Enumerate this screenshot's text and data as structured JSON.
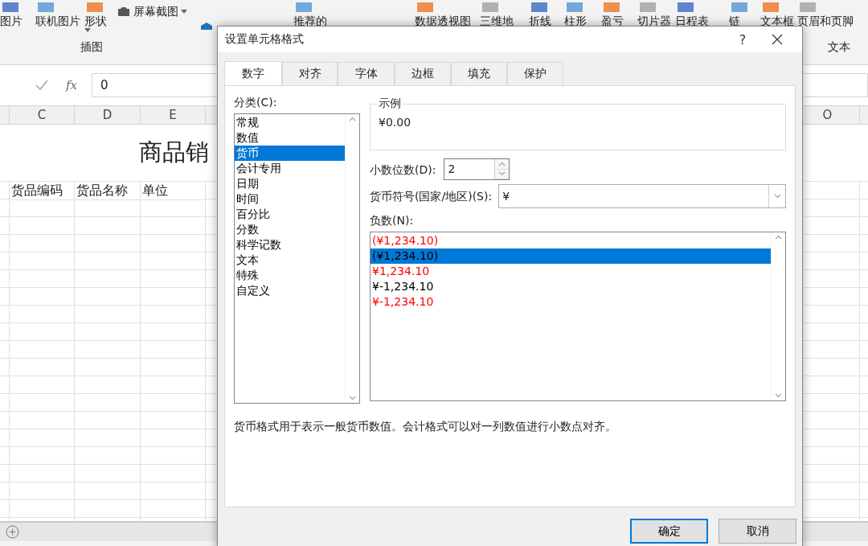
{
  "ribbon": {
    "items": [
      {
        "kind": "large",
        "label": "图片",
        "dropdown": false
      },
      {
        "kind": "large",
        "label": "联机图片",
        "dropdown": false
      },
      {
        "kind": "large",
        "label": "形状",
        "dropdown": true
      },
      {
        "kind": "stack",
        "entries": [
          {
            "label": "屏幕截图",
            "dropdown": true
          }
        ]
      },
      {
        "kind": "addin"
      },
      {
        "kind": "large",
        "label": "推荐的",
        "dropdown": false
      },
      {
        "kind": "large",
        "label": "数据透视图",
        "dropdown": false
      },
      {
        "kind": "large",
        "label": "三维地",
        "dropdown": false
      },
      {
        "kind": "large",
        "label": "折线",
        "dropdown": false
      },
      {
        "kind": "large",
        "label": "柱形",
        "dropdown": false
      },
      {
        "kind": "large",
        "label": "盈亏",
        "dropdown": false
      },
      {
        "kind": "large",
        "label": "切片器",
        "dropdown": false
      },
      {
        "kind": "large",
        "label": "日程表",
        "dropdown": false
      },
      {
        "kind": "large",
        "label": "链",
        "dropdown": false
      },
      {
        "kind": "large",
        "label": "文本框",
        "dropdown": false
      },
      {
        "kind": "large",
        "label": "页眉和页脚",
        "dropdown": false
      }
    ],
    "groups": [
      {
        "label": "插图"
      },
      {
        "label": "文本"
      }
    ]
  },
  "formula_bar": {
    "fx": "fx",
    "value": "0"
  },
  "sheet": {
    "columns": [
      "C",
      "D",
      "E",
      "O"
    ],
    "title": "商品销",
    "headers": [
      "货品编码",
      "货品名称",
      "单位"
    ]
  },
  "dialog": {
    "title": "设置单元格格式",
    "help": "?",
    "tabs": [
      {
        "label": "数字",
        "selected": true
      },
      {
        "label": "对齐",
        "selected": false
      },
      {
        "label": "字体",
        "selected": false
      },
      {
        "label": "边框",
        "selected": false
      },
      {
        "label": "填充",
        "selected": false
      },
      {
        "label": "保护",
        "selected": false
      }
    ],
    "category_label": "分类(C):",
    "categories": [
      {
        "label": "常规",
        "selected": false
      },
      {
        "label": "数值",
        "selected": false
      },
      {
        "label": "货币",
        "selected": true
      },
      {
        "label": "会计专用",
        "selected": false
      },
      {
        "label": "日期",
        "selected": false
      },
      {
        "label": "时间",
        "selected": false
      },
      {
        "label": "百分比",
        "selected": false
      },
      {
        "label": "分数",
        "selected": false
      },
      {
        "label": "科学记数",
        "selected": false
      },
      {
        "label": "文本",
        "selected": false
      },
      {
        "label": "特殊",
        "selected": false
      },
      {
        "label": "自定义",
        "selected": false
      }
    ],
    "sample": {
      "label": "示例",
      "value": "¥0.00"
    },
    "decimals": {
      "label": "小数位数(D):",
      "value": "2"
    },
    "symbol": {
      "label": "货币符号(国家/地区)(S):",
      "value": "¥"
    },
    "negative_label": "负数(N):",
    "negatives": [
      {
        "label": "(¥1,234.10)",
        "color": "#ff0000",
        "selected": false
      },
      {
        "label": "(¥1,234.10)",
        "color": "#000000",
        "selected": true
      },
      {
        "label": "¥1,234.10",
        "color": "#ff0000",
        "selected": false
      },
      {
        "label": "¥-1,234.10",
        "color": "#000000",
        "selected": false
      },
      {
        "label": "¥-1,234.10",
        "color": "#ff0000",
        "selected": false
      }
    ],
    "description": "货币格式用于表示一般货币数值。会计格式可以对一列数值进行小数点对齐。",
    "buttons": [
      "确定",
      "取消"
    ]
  }
}
